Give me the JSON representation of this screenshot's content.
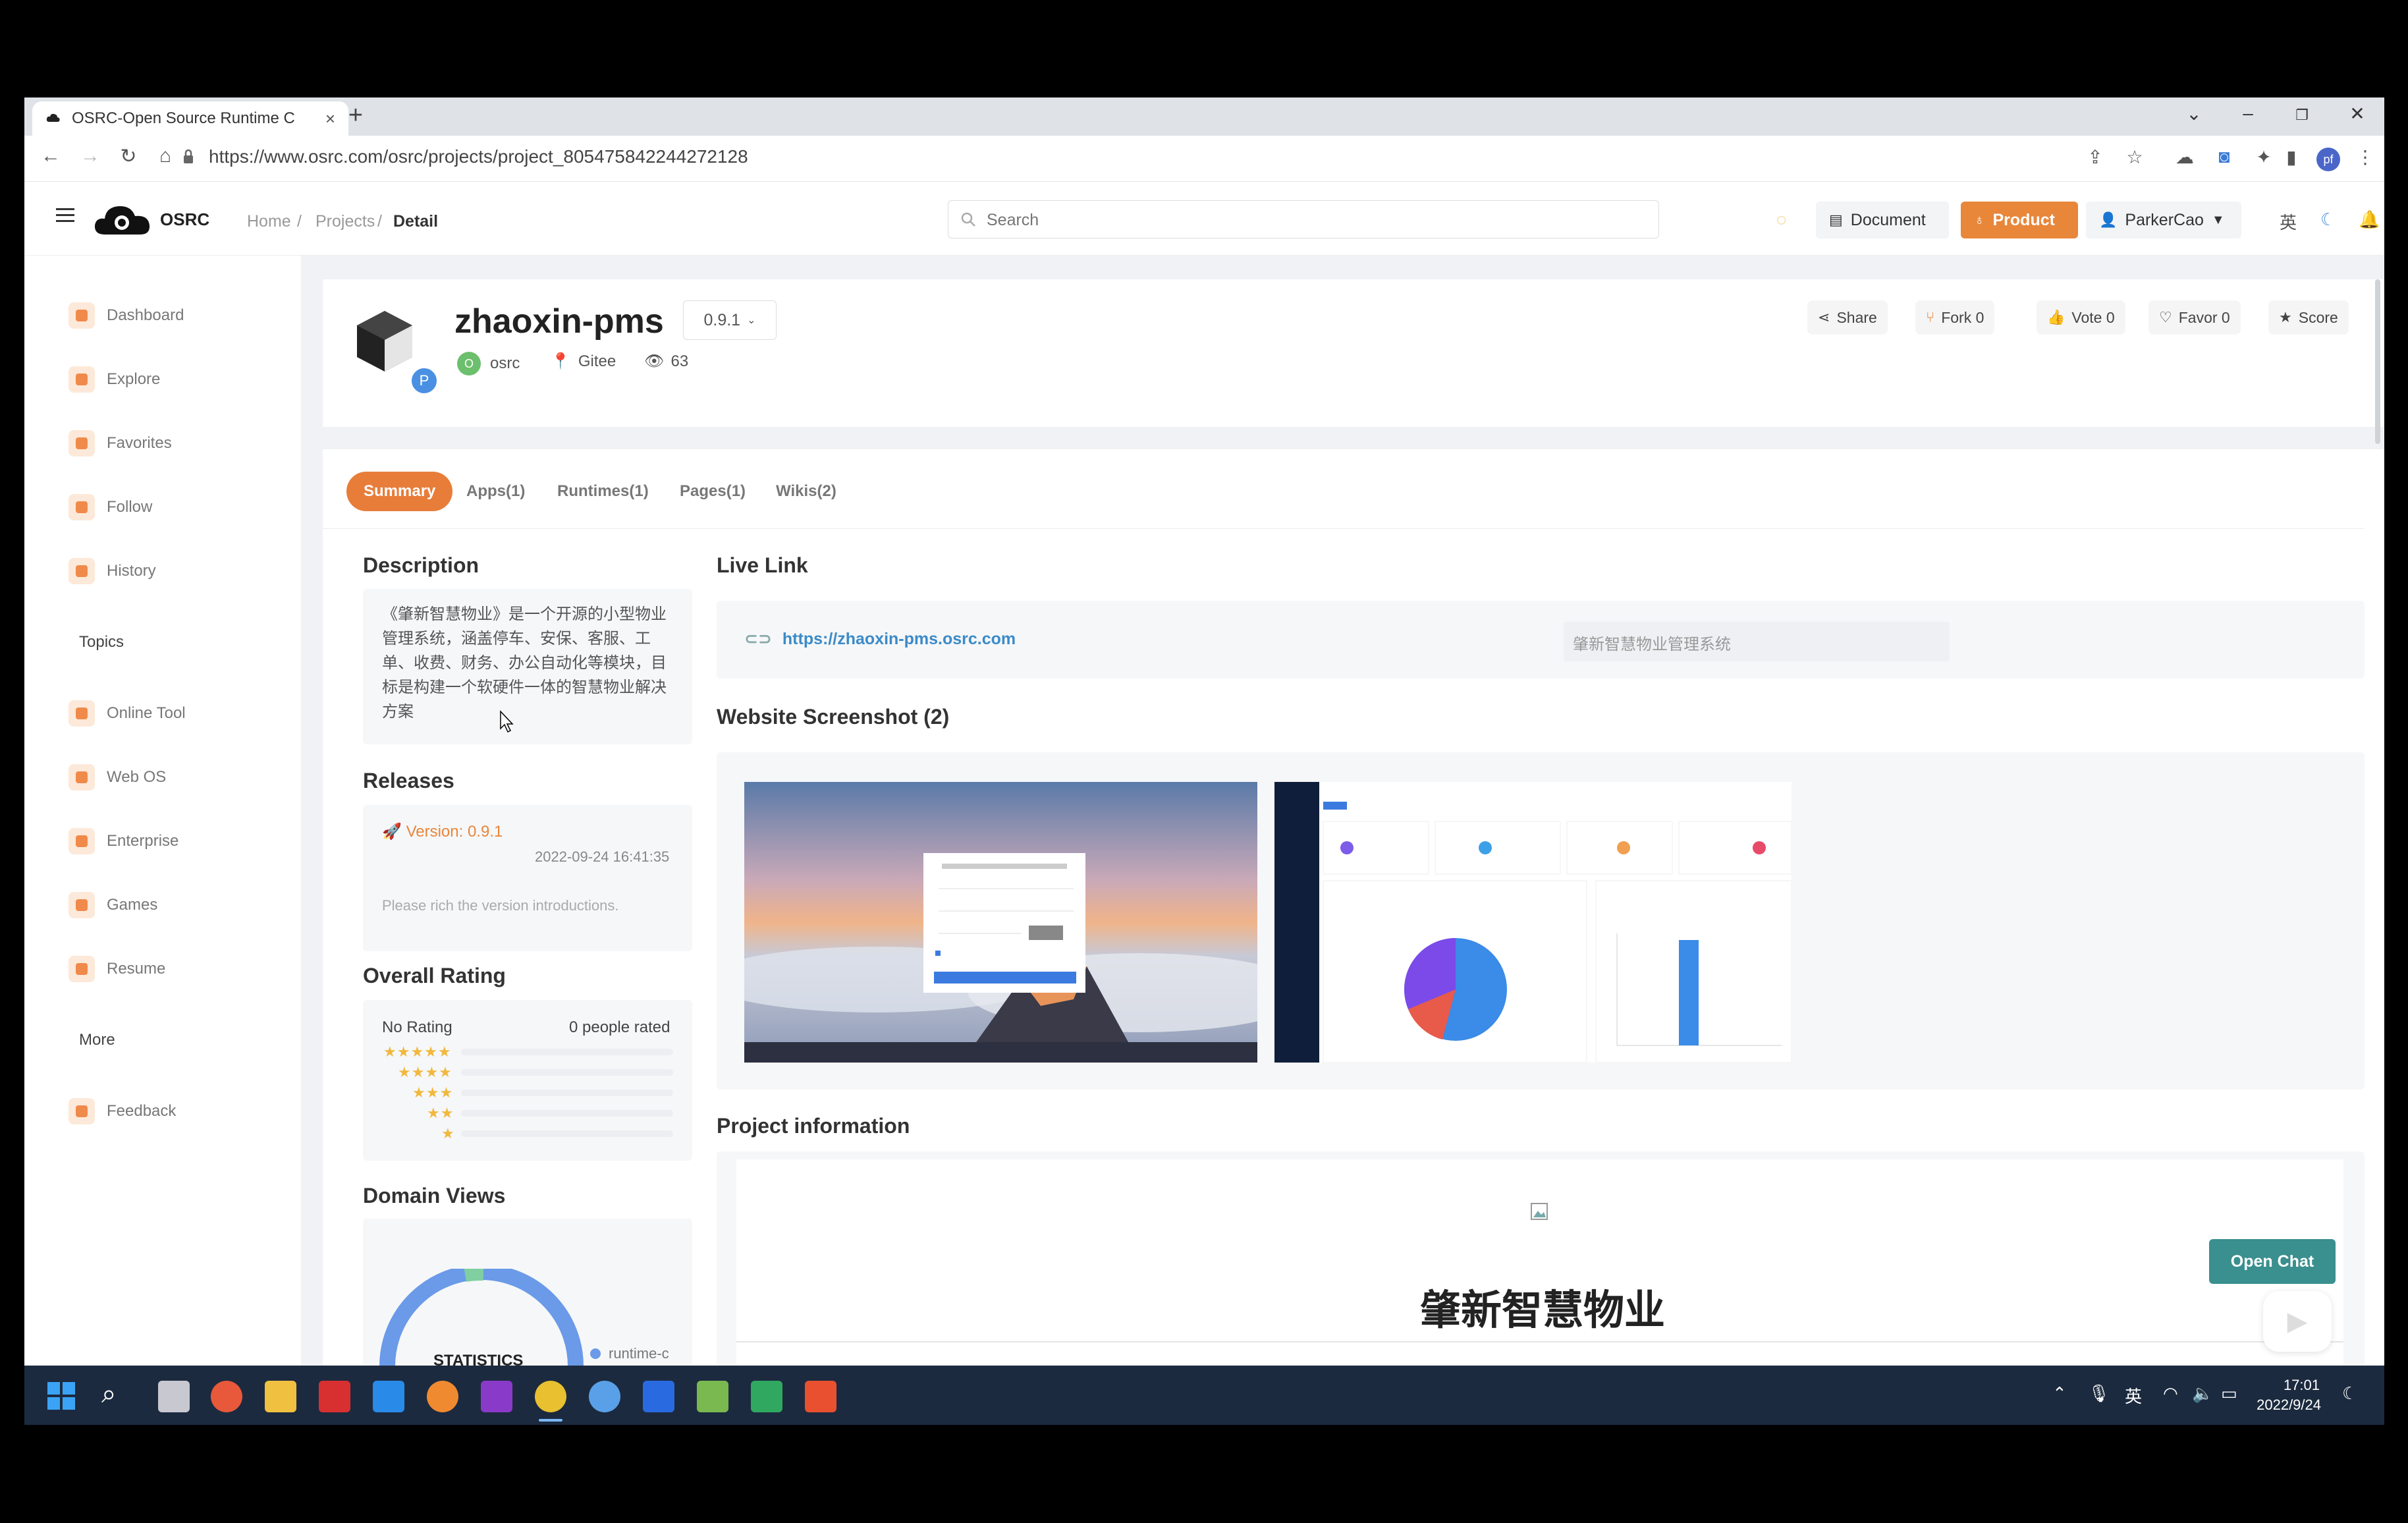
{
  "browser": {
    "tab_title": "OSRC-Open Source Runtime C",
    "new_tab": "+",
    "url": "https://www.osrc.com/osrc/projects/project_805475842244272128",
    "profile_initials": "pf"
  },
  "header": {
    "logo_text": "OSRC",
    "breadcrumb": {
      "home": "Home",
      "sep1": "/",
      "projects": "Projects",
      "sep2": "/",
      "current": "Detail"
    },
    "search_placeholder": "Search",
    "document_label": "Document",
    "product_label": "Product",
    "user_label": "ParkerCao",
    "lang_label": "英"
  },
  "sidebar": {
    "items_top": [
      "Dashboard",
      "Explore",
      "Favorites",
      "Follow",
      "History"
    ],
    "topics_heading": "Topics",
    "items_topics": [
      "Online Tool",
      "Web OS",
      "Enterprise",
      "Games",
      "Resume"
    ],
    "more_heading": "More",
    "items_bottom": [
      "Feedback"
    ]
  },
  "project": {
    "badge": "P",
    "name": "zhaoxin-pms",
    "version": "0.9.1",
    "owner_initial": "O",
    "owner": "osrc",
    "source": "Gitee",
    "views": "63",
    "actions": {
      "share": "Share",
      "fork": "Fork 0",
      "vote": "Vote 0",
      "favor": "Favor 0",
      "score": "Score"
    }
  },
  "tabs": [
    "Summary",
    "Apps(1)",
    "Runtimes(1)",
    "Pages(1)",
    "Wikis(2)"
  ],
  "description": {
    "heading": "Description",
    "text": "《肇新智慧物业》是一个开源的小型物业管理系统，涵盖停车、安保、客服、工单、收费、财务、办公自动化等模块，目标是构建一个软硬件一体的智慧物业解决方案"
  },
  "releases": {
    "heading": "Releases",
    "version_label": "Version: 0.9.1",
    "date": "2022-09-24 16:41:35",
    "note": "Please rich the version introductions."
  },
  "rating": {
    "heading": "Overall Rating",
    "status": "No Rating",
    "count_text": "0 people rated",
    "rows": [
      5,
      4,
      3,
      2,
      1
    ]
  },
  "domain_views": {
    "heading": "Domain Views",
    "center_label": "STATISTICS",
    "legend": "runtime-c"
  },
  "live_link": {
    "heading": "Live Link",
    "url": "https://zhaoxin-pms.osrc.com",
    "title": "肇新智慧物业管理系统"
  },
  "screenshots": {
    "heading": "Website Screenshot (2)"
  },
  "project_info": {
    "heading": "Project information",
    "title": "肇新智慧物业"
  },
  "chat": {
    "label": "Open Chat"
  },
  "taskbar": {
    "lang": "英",
    "time": "17:01",
    "date": "2022/9/24"
  },
  "colors": {
    "accent": "#e8863a",
    "chat": "#3a8f8f",
    "link": "#3b8bc8"
  }
}
